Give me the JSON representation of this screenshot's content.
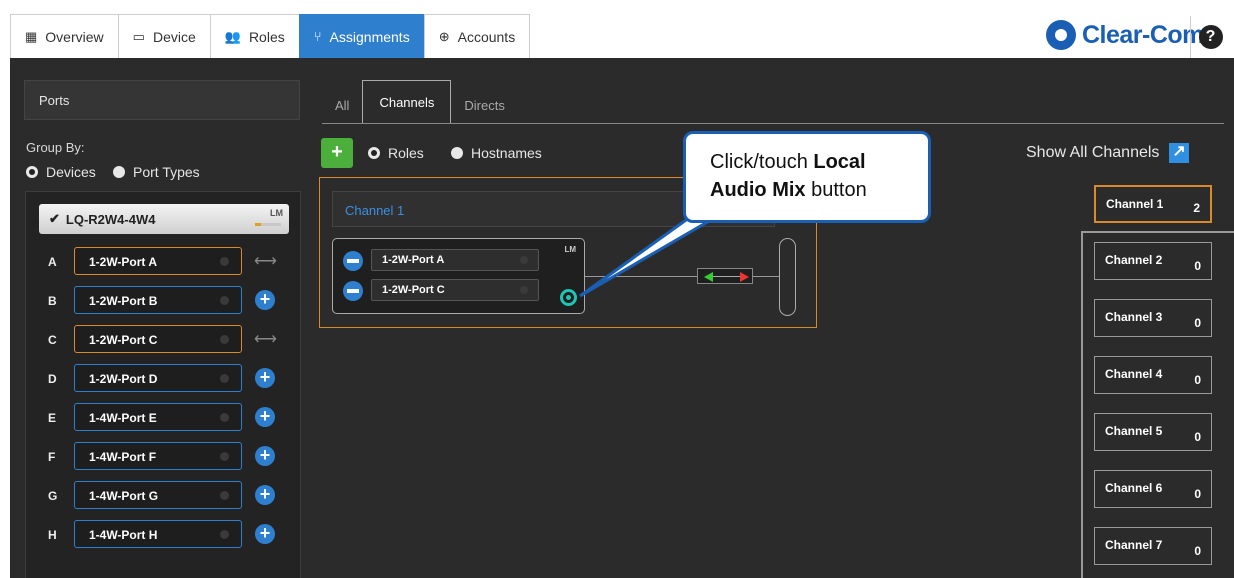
{
  "nav": {
    "tabs": [
      {
        "label": "Overview",
        "icon": "overview-icon",
        "glyph": "▦"
      },
      {
        "label": "Device",
        "icon": "device-icon",
        "glyph": "▭"
      },
      {
        "label": "Roles",
        "icon": "roles-icon",
        "glyph": "👥"
      },
      {
        "label": "Assignments",
        "icon": "assignments-icon",
        "glyph": "⑂",
        "active": true
      },
      {
        "label": "Accounts",
        "icon": "accounts-icon",
        "glyph": "⊕"
      }
    ],
    "logo_text": "Clear-Com",
    "help_label": "?"
  },
  "left": {
    "ports_label": "Ports",
    "group_by_label": "Group By:",
    "group_options": [
      {
        "label": "Devices",
        "selected": true
      },
      {
        "label": "Port Types",
        "selected": false
      }
    ],
    "device": {
      "name": "LQ-R2W4-4W4",
      "lm_label": "LM"
    },
    "ports": [
      {
        "letter": "A",
        "name": "1-2W-Port A",
        "assigned": true
      },
      {
        "letter": "B",
        "name": "1-2W-Port B",
        "assigned": false
      },
      {
        "letter": "C",
        "name": "1-2W-Port C",
        "assigned": true
      },
      {
        "letter": "D",
        "name": "1-2W-Port D",
        "assigned": false
      },
      {
        "letter": "E",
        "name": "1-4W-Port E",
        "assigned": false
      },
      {
        "letter": "F",
        "name": "1-4W-Port F",
        "assigned": false
      },
      {
        "letter": "G",
        "name": "1-4W-Port G",
        "assigned": false
      },
      {
        "letter": "H",
        "name": "1-4W-Port H",
        "assigned": false
      }
    ]
  },
  "center": {
    "subtabs": [
      "All",
      "Channels",
      "Directs"
    ],
    "active_subtab": "Channels",
    "add_label": "+",
    "view_options": [
      {
        "label": "Roles",
        "selected": true
      },
      {
        "label": "Hostnames",
        "selected": false
      }
    ],
    "channel": {
      "name": "Channel 1",
      "lm_label": "LM",
      "members": [
        "1-2W-Port A",
        "1-2W-Port C"
      ]
    }
  },
  "callout": {
    "line1": "Click/touch",
    "bold1": "Local",
    "bold2": "Audio Mix",
    "line2_rest": "button"
  },
  "right": {
    "show_all_label": "Show All Channels",
    "channels": [
      {
        "name": "Channel 1",
        "count": "2",
        "active": true
      },
      {
        "name": "Channel 2",
        "count": "0"
      },
      {
        "name": "Channel 3",
        "count": "0"
      },
      {
        "name": "Channel 4",
        "count": "0"
      },
      {
        "name": "Channel 5",
        "count": "0"
      },
      {
        "name": "Channel 6",
        "count": "0"
      },
      {
        "name": "Channel 7",
        "count": "0"
      }
    ]
  },
  "colors": {
    "accent_blue": "#2f7fcf",
    "assigned_orange": "#d98a2b",
    "add_green": "#4caf3c",
    "lm_teal": "#1fc4b4",
    "background": "#2b2b2b"
  }
}
